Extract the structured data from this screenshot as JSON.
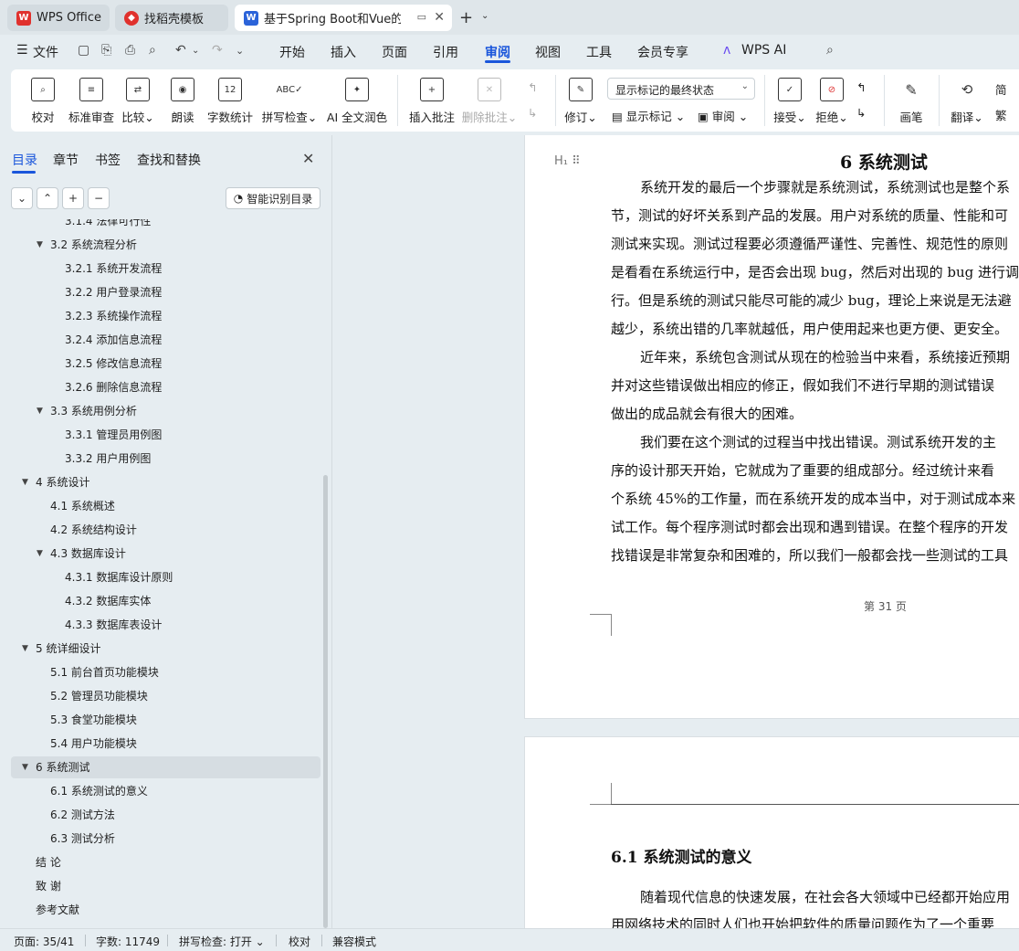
{
  "tabs": [
    {
      "label": "WPS Office",
      "icon": "wps-logo-icon"
    },
    {
      "label": "找稻壳模板",
      "icon": "docer-logo-icon"
    },
    {
      "label": "基于Spring Boot和Vue的高",
      "icon": "word-doc-icon"
    }
  ],
  "menu": {
    "file": "文件",
    "items": [
      "开始",
      "插入",
      "页面",
      "引用",
      "审阅",
      "视图",
      "工具",
      "会员专享",
      "WPS AI"
    ],
    "active": "审阅"
  },
  "ribbon": {
    "proof": "校对",
    "standard_review": "标准审查",
    "compare": "比较",
    "read_aloud": "朗读",
    "word_count": "字数统计",
    "spell_check": "拼写检查",
    "ai_polish": "AI 全文润色",
    "insert_comment": "插入批注",
    "delete_comment": "删除批注",
    "track_changes": "修订",
    "markup_display_value": "显示标记的最终状态",
    "show_markup": "显示标记",
    "review": "审阅",
    "accept": "接受",
    "reject": "拒绝",
    "pen": "画笔",
    "translate": "翻译",
    "simp_label": "简",
    "trad_label": "繁"
  },
  "sidebar": {
    "tabs": [
      "目录",
      "章节",
      "书签",
      "查找和替换"
    ],
    "smart_toc": "智能识别目录",
    "toc": [
      {
        "label": "3.1.4  法律可行性",
        "level": 3,
        "caret": false
      },
      {
        "label": "3.2 系统流程分析",
        "level": 2,
        "caret": true
      },
      {
        "label": "3.2.1 系统开发流程",
        "level": 3,
        "caret": false
      },
      {
        "label": "3.2.2  用户登录流程",
        "level": 3,
        "caret": false
      },
      {
        "label": "3.2.3  系统操作流程",
        "level": 3,
        "caret": false
      },
      {
        "label": "3.2.4  添加信息流程",
        "level": 3,
        "caret": false
      },
      {
        "label": "3.2.5  修改信息流程",
        "level": 3,
        "caret": false
      },
      {
        "label": "3.2.6  删除信息流程",
        "level": 3,
        "caret": false
      },
      {
        "label": "3.3 系统用例分析",
        "level": 2,
        "caret": true
      },
      {
        "label": "3.3.1 管理员用例图",
        "level": 3,
        "caret": false
      },
      {
        "label": "3.3.2 用户用例图",
        "level": 3,
        "caret": false
      },
      {
        "label": "4  系统设计",
        "level": 1,
        "caret": true
      },
      {
        "label": "4.1  系统概述",
        "level": 2,
        "caret": false
      },
      {
        "label": "4.2  系统结构设计",
        "level": 2,
        "caret": false
      },
      {
        "label": "4.3 数据库设计",
        "level": 2,
        "caret": true
      },
      {
        "label": "4.3.1  数据库设计原则",
        "level": 3,
        "caret": false
      },
      {
        "label": "4.3.2  数据库实体",
        "level": 3,
        "caret": false
      },
      {
        "label": "4.3.3  数据库表设计",
        "level": 3,
        "caret": false
      },
      {
        "label": "5 统详细设计",
        "level": 1,
        "caret": true
      },
      {
        "label": "5.1 前台首页功能模块",
        "level": 2,
        "caret": false
      },
      {
        "label": "5.2 管理员功能模块",
        "level": 2,
        "caret": false
      },
      {
        "label": "5.3 食堂功能模块",
        "level": 2,
        "caret": false
      },
      {
        "label": "5.4 用户功能模块",
        "level": 2,
        "caret": false
      },
      {
        "label": "6 系统测试",
        "level": 1,
        "caret": true,
        "selected": true
      },
      {
        "label": "6.1 系统测试的意义",
        "level": 2,
        "caret": false
      },
      {
        "label": "6.2  测试方法",
        "level": 2,
        "caret": false
      },
      {
        "label": "6.3 测试分析",
        "level": 2,
        "caret": false
      },
      {
        "label": "结      论",
        "level": 1,
        "caret": false
      },
      {
        "label": "致      谢",
        "level": 1,
        "caret": false
      },
      {
        "label": "参考文献",
        "level": 1,
        "caret": false
      }
    ]
  },
  "document": {
    "chapter_title": "6 系统测试",
    "paragraphs": [
      "系统开发的最后一个步骤就是系统测试，系统测试也是整个系",
      "节，测试的好坏关系到产品的发展。用户对系统的质量、性能和可",
      "测试来实现。测试过程要必须遵循严谨性、完善性、规范性的原则",
      "是看看在系统运行中，是否会出现 bug，然后对出现的 bug 进行调",
      "行。但是系统的测试只能尽可能的减少 bug，理论上来说是无法避",
      "越少，系统出错的几率就越低，用户使用起来也更方便、更安全。",
      "近年来，系统包含测试从现在的检验当中来看，系统接近预期",
      "并对这些错误做出相应的修正，假如我们不进行早期的测试错误",
      "做出的成品就会有很大的困难。",
      "我们要在这个测试的过程当中找出错误。测试系统开发的主",
      "序的设计那天开始，它就成为了重要的组成部分。经过统计来看",
      "个系统 45%的工作量，而在系统开发的成本当中，对于测试成本来",
      "试工作。每个程序测试时都会出现和遇到错误。在整个程序的开发",
      "找错误是非常复杂和困难的，所以我们一般都会找一些测试的工具"
    ],
    "page_number": "第 31 页",
    "section_title": "6.1 系统测试的意义",
    "next_paragraphs": [
      "随着现代信息的快速发展，在社会各大领域中已经都开始应用",
      "用网络技术的同时人们也开始把软件的质量问题作为了一个重要"
    ]
  },
  "status": {
    "page": "页面: 35/41",
    "words": "字数: 11749",
    "spell": "拼写检查: 打开",
    "proof": "校对",
    "compat": "兼容模式"
  },
  "colors": {
    "accent": "#1a56db",
    "wps_red": "#e0312d",
    "word_blue": "#2b63d9"
  }
}
